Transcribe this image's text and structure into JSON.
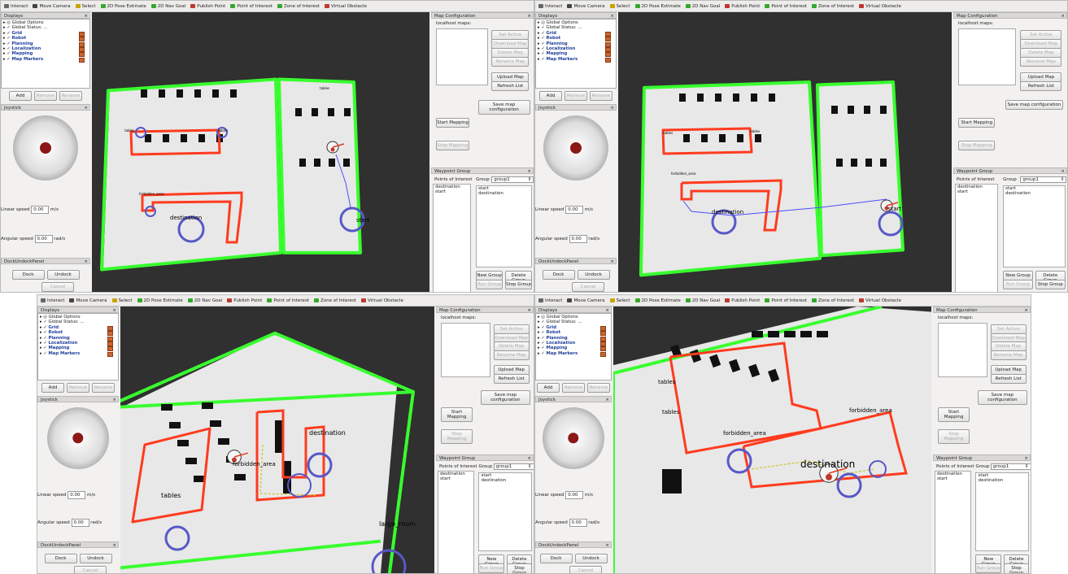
{
  "toolbar": {
    "items": [
      "Interact",
      "Move Camera",
      "Select",
      "2D Pose Estimate",
      "2D Nav Goal",
      "Publish Point",
      "Point of Interest",
      "Zone of Interest",
      "Virtual Obstacle"
    ],
    "icon_colors": [
      "#666666",
      "#444444",
      "#c9a400",
      "#34a82b",
      "#34a82b",
      "#c0392b",
      "#34a82b",
      "#34a82b",
      "#c0392b"
    ]
  },
  "displays": {
    "title": "Displays",
    "items": [
      {
        "label": "Global Options",
        "checked": false,
        "highlight": false
      },
      {
        "label": "Global Status: ...",
        "checked": true,
        "highlight": false
      },
      {
        "label": "Grid",
        "checked": true,
        "highlight": true
      },
      {
        "label": "Robot",
        "checked": true,
        "highlight": true
      },
      {
        "label": "Planning",
        "checked": true,
        "highlight": true
      },
      {
        "label": "Localization",
        "checked": true,
        "highlight": true
      },
      {
        "label": "Mapping",
        "checked": true,
        "highlight": true
      },
      {
        "label": "Map Markers",
        "checked": true,
        "highlight": true
      }
    ],
    "buttons": {
      "add": "Add",
      "remove": "Remove",
      "rename": "Rename"
    }
  },
  "joystick": {
    "title": "Joystick",
    "linear_label": "Linear speed",
    "linear_value": "0.00",
    "linear_unit": "m/s",
    "angular_label": "Angular speed",
    "angular_value": "0.00",
    "angular_unit": "rad/s"
  },
  "dock_panel": {
    "title": "DockUndockPanel",
    "dock": "Dock",
    "undock": "Undock",
    "cancel": "Cancel"
  },
  "map_config": {
    "title": "Map Configuration",
    "maps_label": "localhost maps:",
    "buttons": [
      "Set Active",
      "Download Map",
      "Delete Map",
      "Rename Map",
      "Upload Map",
      "Refresh List"
    ],
    "save": "Save map configuration",
    "start_mapping": "Start Mapping",
    "stop_mapping": "Stop Mapping"
  },
  "waypoint": {
    "title": "Waypoint Group",
    "poi_label": "Points of Interest",
    "group_label": "Group",
    "group_value": "group1",
    "poi_items": [
      "destination",
      "start"
    ],
    "group_items": [
      "start",
      "destination"
    ],
    "buttons": {
      "new_group": "New Group",
      "delete_group": "Delete Group",
      "run_group": "Run Group",
      "stop_group": "Stop Group"
    }
  },
  "map_labels": {
    "q1": [
      "tables",
      "tables",
      "tables",
      "forbidden_area",
      "start",
      "destination"
    ],
    "q2": [
      "tables",
      "tables",
      "forbidden_area",
      "destination",
      "start"
    ],
    "q3": [
      "forbidden_area",
      "tables",
      "destination",
      "large_room"
    ],
    "q4": [
      "tables",
      "tables",
      "forbidden_area",
      "destination",
      "forbidden_area"
    ]
  },
  "colors": {
    "zone": "#ff3b1f",
    "boundary": "#39ff2f",
    "floor": "#e8e8e8",
    "obstacle": "#111111",
    "viewport_bg": "#303030",
    "link": "#1f3f9a"
  }
}
